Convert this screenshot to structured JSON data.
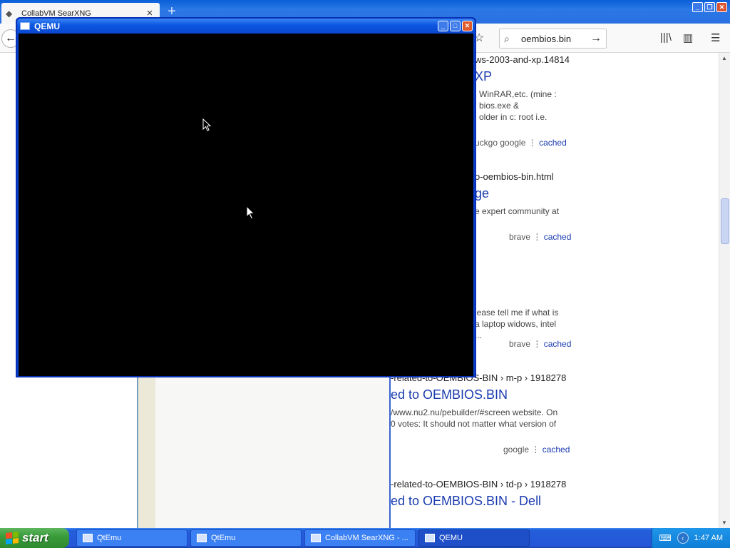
{
  "browser": {
    "tab": {
      "title": "CollabVM SearXNG",
      "close": "×"
    },
    "newtab": "+",
    "search": {
      "value": "oembios.bin"
    },
    "icons": {
      "back": "←",
      "star": "☆",
      "search": "⌕",
      "go": "→",
      "library": "|||\\",
      "sidebar": "▥",
      "menu": "☰"
    }
  },
  "results": [
    {
      "url": "ws-2003-and-xp.14814",
      "title": "XP",
      "snippet": [
        "WinRAR,etc. (mine :",
        "bios.exe &",
        "older in c: root i.e."
      ],
      "engines": "uckgo   google   ⋮   ",
      "cached": "cached"
    },
    {
      "url": "o-oembios-bin.html",
      "title": "ge",
      "snippet": [
        "e expert community at"
      ],
      "engines": "brave   ⋮   ",
      "cached": "cached"
    },
    {
      "url": "",
      "title": "",
      "snippet": [
        "lease tell me if what is",
        "a laptop widows, intel",
        "..."
      ],
      "engines": "brave   ⋮   ",
      "cached": "cached"
    },
    {
      "url": "-related-to-OEMBIOS-BIN › m-p › 1918278",
      "title": "ed to OEMBIOS.BIN",
      "snippet": [
        "/www.nu2.nu/pebuilder/#screen website. On",
        "0 votes: It should not matter what version of"
      ],
      "engines": "google   ⋮   ",
      "cached": "cached"
    },
    {
      "url": "-related-to-OEMBIOS-BIN › td-p › 1918278",
      "title": "ed to OEMBIOS.BIN - Dell",
      "snippet": [],
      "engines": "",
      "cached": ""
    }
  ],
  "qemu": {
    "title": "QEMU",
    "buttons": {
      "minimize": "_",
      "maximize": "□",
      "close": "✕"
    }
  },
  "taskbar": {
    "start_label": "start",
    "tasks": [
      {
        "label": "QtEmu"
      },
      {
        "label": "QtEmu"
      },
      {
        "label": "CollabVM SearXNG - ..."
      },
      {
        "label": "QEMU"
      }
    ],
    "clock": "1:47 AM",
    "tray_icons": {
      "keyboard": "⌨",
      "volume": "‹"
    }
  },
  "colors": {
    "xp_blue": "#2557d8",
    "start_green": "#3a9c3a",
    "link": "#1a3bb0"
  }
}
